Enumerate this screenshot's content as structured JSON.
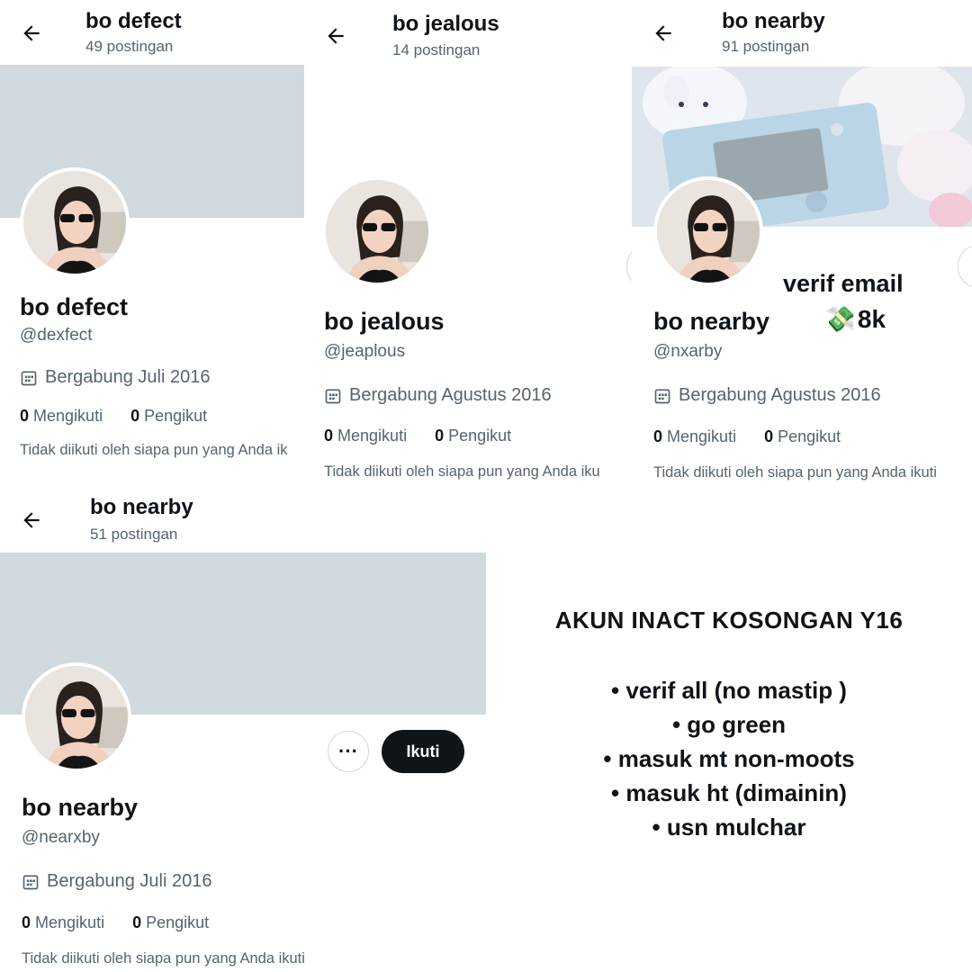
{
  "profiles": [
    {
      "header_title": "bo defect",
      "posts": "49 postingan",
      "name": "bo defect",
      "handle": "@dexfect",
      "joined": "Bergabung Juli 2016",
      "following_count": "0",
      "following_label": "Mengikuti",
      "followers_count": "0",
      "followers_label": "Pengikut",
      "followed_note": "Tidak diikuti oleh siapa pun yang Anda ik"
    },
    {
      "header_title": "bo jealous",
      "posts": "14 postingan",
      "name": "bo jealous",
      "handle": "@jeaplous",
      "joined": "Bergabung Agustus 2016",
      "following_count": "0",
      "following_label": "Mengikuti",
      "followers_count": "0",
      "followers_label": "Pengikut",
      "followed_note": "Tidak diikuti oleh siapa pun yang Anda iku"
    },
    {
      "header_title": "bo nearby",
      "posts": "91 postingan",
      "name": "bo nearby",
      "handle": "@nxarby",
      "joined": "Bergabung Agustus 2016",
      "following_count": "0",
      "following_label": "Mengikuti",
      "followers_count": "0",
      "followers_label": "Pengikut",
      "followed_note": "Tidak diikuti oleh siapa pun yang Anda ikuti"
    },
    {
      "header_title": "bo nearby",
      "posts": "51 postingan",
      "name": "bo nearby",
      "handle": "@nearxby",
      "joined": "Bergabung Juli 2016",
      "following_count": "0",
      "following_label": "Mengikuti",
      "followers_count": "0",
      "followers_label": "Pengikut",
      "followed_note": "Tidak diikuti oleh siapa pun yang Anda ikuti",
      "more_label": "···",
      "follow_label": "Ikuti"
    }
  ],
  "overlay": {
    "verif_text": "verif email",
    "price_icon": "💸",
    "price_text": "8k"
  },
  "promo": {
    "title": "AKUN INACT KOSONGAN Y16",
    "items": [
      "• verif all (no mastip )",
      "• go green",
      "• masuk mt non-moots",
      "• masuk ht (dimainin)",
      "• usn mulchar"
    ]
  },
  "colors": {
    "banner": "#cfd9de",
    "text_primary": "#0f1419",
    "text_secondary": "#536471",
    "button_dark": "#0f1419"
  }
}
